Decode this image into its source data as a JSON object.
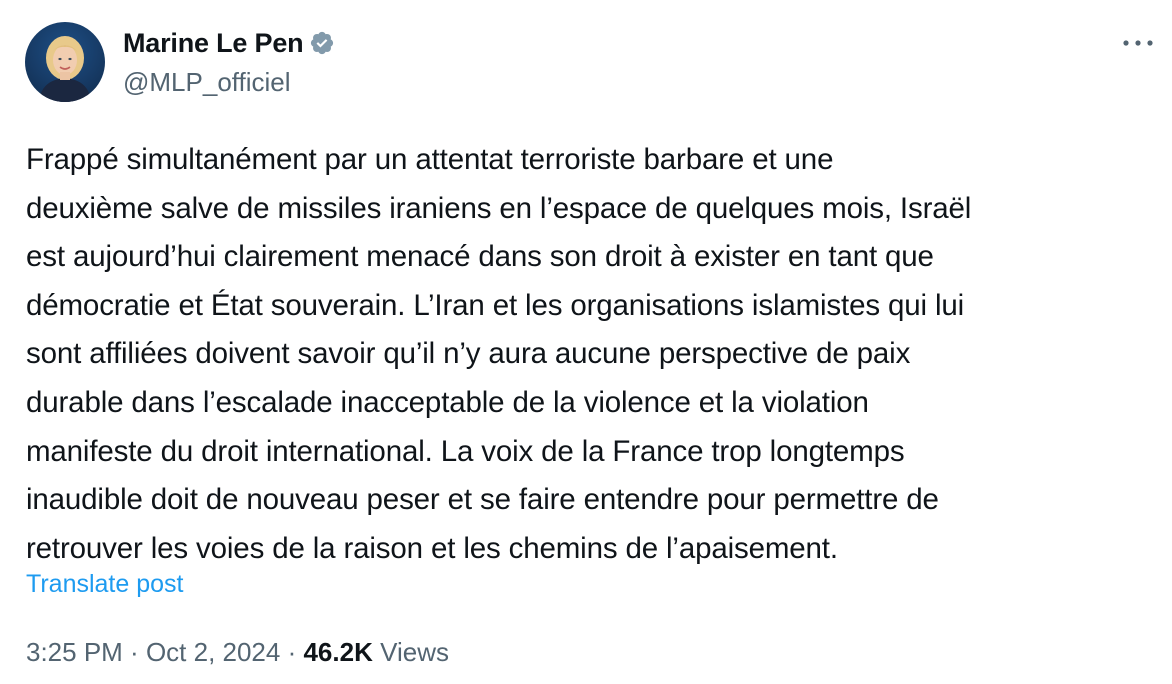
{
  "author": {
    "name": "Marine Le Pen",
    "handle": "@MLP_officiel",
    "verified_color": "#829aab"
  },
  "tweet": {
    "text": "Frappé simultanément par un attentat terroriste barbare et une\ndeuxième salve de missiles iraniens en l’espace de quelques mois, Israël\nest aujourd’hui clairement menacé dans son droit à exister en tant que\ndémocratie et État souverain. L’Iran et les organisations  islamistes qui lui\nsont affiliées doivent savoir qu’il n’y aura aucune perspective de paix\ndurable dans l’escalade inacceptable de la violence et la violation\nmanifeste du droit international. La voix de la France trop longtemps\ninaudible doit de nouveau peser et se faire entendre pour permettre de\nretrouver les voies de la raison et les chemins de l’apaisement.",
    "translate_label": "Translate post"
  },
  "meta": {
    "time": "3:25 PM",
    "separator": " · ",
    "date": "Oct 2, 2024",
    "views_count": "46.2K",
    "views_label": "Views"
  },
  "colors": {
    "text_primary": "#0f1419",
    "text_secondary": "#536471",
    "link": "#1d9bf0"
  },
  "icons": {
    "more": "more-horizontal-icon",
    "verified": "verified-badge-icon"
  }
}
